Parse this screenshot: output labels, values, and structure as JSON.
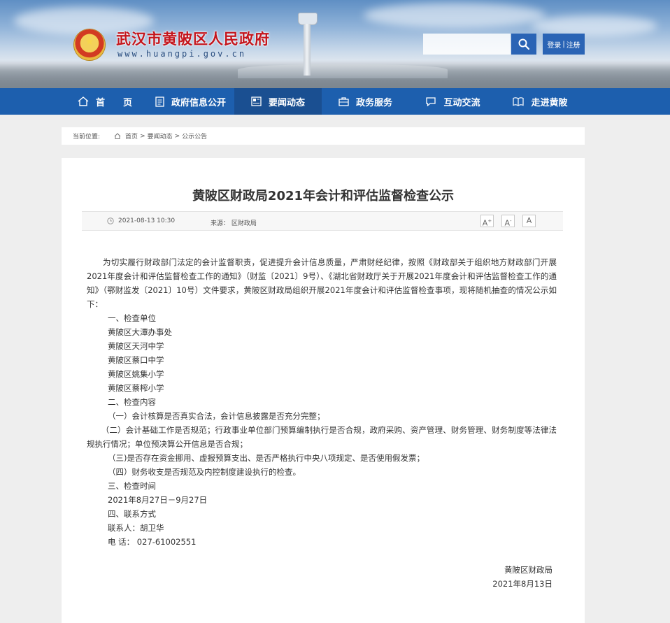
{
  "header": {
    "site_title": "武汉市黄陂区人民政府",
    "site_url": "www.huangpi.gov.cn",
    "search_placeholder": "",
    "login_label": "登录",
    "separator": "|",
    "register_label": "注册"
  },
  "nav": {
    "items": [
      {
        "label": "首　　页",
        "icon": "home-icon"
      },
      {
        "label": "政府信息公开",
        "icon": "document-icon"
      },
      {
        "label": "要闻动态",
        "icon": "newspaper-icon"
      },
      {
        "label": "政务服务",
        "icon": "briefcase-icon"
      },
      {
        "label": "互动交流",
        "icon": "chat-icon"
      },
      {
        "label": "走进黄陂",
        "icon": "book-icon"
      }
    ],
    "active_index": 2
  },
  "breadcrumb": {
    "label": "当前位置:",
    "items": [
      "首页",
      "要闻动态",
      "公示公告"
    ],
    "separator": ">"
  },
  "article": {
    "title": "黄陂区财政局2021年会计和评估监督检查公示",
    "date": "2021-08-13 10:30",
    "source": "来源： 区财政局",
    "font_buttons": [
      "A",
      "A",
      "A"
    ],
    "intro": "为切实履行财政部门法定的会计监督职责，促进提升会计信息质量，严肃财经纪律，按照《财政部关于组织地方财政部门开展2021年度会计和评估监督检查工作的通知》（财监〔2021〕9号）、《湖北省财政厅关于开展2021年度会计和评估监督检查工作的通知》（鄂财监发〔2021〕10号）文件要求，黄陂区财政局组织开展2021年度会计和评估监督检查事项，现将随机抽查的情况公示如下：",
    "lines": [
      "一、检查单位",
      "黄陂区大潭办事处",
      "黄陂区天河中学",
      "黄陂区蔡口中学",
      "黄陂区姚集小学",
      "黄陂区蔡榨小学",
      "二、检查内容",
      "（一）会计核算是否真实合法，会计信息披露是否充分完整；"
    ],
    "item2": "（二）会计基础工作是否规范；行政事业单位部门预算编制执行是否合规，政府采购、资产管理、财务管理、财务制度等法律法规执行情况；单位预决算公开信息是否合规；",
    "lines2": [
      "（三)是否存在资金挪用、虚报预算支出、是否严格执行中央八项规定、是否使用假发票；",
      "（四）财务收支是否规范及内控制度建设执行的检查。",
      "三、检查时间",
      "2021年8月27日－9月27日",
      "四、联系方式",
      "联系人：胡卫华",
      "电  话： 027-61002551"
    ],
    "signature": "黄陂区财政局",
    "sign_date": "2021年8月13日"
  },
  "colors": {
    "nav_bg": "#1d5fae",
    "nav_active": "#1a4f91",
    "title_red": "#c4151c",
    "button_blue": "#2a64b5"
  }
}
